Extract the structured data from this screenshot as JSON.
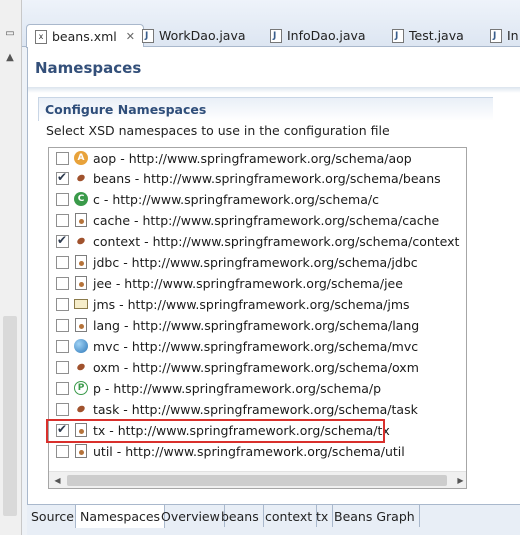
{
  "editor_tabs": [
    {
      "label": "beans.xml",
      "active": true,
      "closable": true,
      "icon": "xml-file-icon"
    },
    {
      "label": "WorkDao.java",
      "icon": "java-file-icon"
    },
    {
      "label": "InfoDao.java",
      "icon": "java-interface-icon"
    },
    {
      "label": "Test.java",
      "icon": "java-interface-icon"
    },
    {
      "label": "In",
      "icon": "java-interface-icon"
    }
  ],
  "page": {
    "title": "Namespaces",
    "section_title": "Configure Namespaces",
    "description": "Select XSD namespaces to use in the configuration file"
  },
  "namespaces": [
    {
      "label": "aop - http://www.springframework.org/schema/aop",
      "checked": false,
      "icon": "aop-icon"
    },
    {
      "label": "beans - http://www.springframework.org/schema/beans",
      "checked": true,
      "icon": "bean-icon"
    },
    {
      "label": "c - http://www.springframework.org/schema/c",
      "checked": false,
      "icon": "c-namespace-icon"
    },
    {
      "label": "cache - http://www.springframework.org/schema/cache",
      "checked": false,
      "icon": "xsd-file-icon"
    },
    {
      "label": "context - http://www.springframework.org/schema/context",
      "checked": true,
      "icon": "bean-icon"
    },
    {
      "label": "jdbc - http://www.springframework.org/schema/jdbc",
      "checked": false,
      "icon": "xsd-file-icon"
    },
    {
      "label": "jee - http://www.springframework.org/schema/jee",
      "checked": false,
      "icon": "xsd-file-icon"
    },
    {
      "label": "jms - http://www.springframework.org/schema/jms",
      "checked": false,
      "icon": "envelope-icon"
    },
    {
      "label": "lang - http://www.springframework.org/schema/lang",
      "checked": false,
      "icon": "xsd-file-icon"
    },
    {
      "label": "mvc - http://www.springframework.org/schema/mvc",
      "checked": false,
      "icon": "globe-icon"
    },
    {
      "label": "oxm - http://www.springframework.org/schema/oxm",
      "checked": false,
      "icon": "bean-icon"
    },
    {
      "label": "p - http://www.springframework.org/schema/p",
      "checked": false,
      "icon": "p-namespace-icon"
    },
    {
      "label": "task - http://www.springframework.org/schema/task",
      "checked": false,
      "icon": "task-icon"
    },
    {
      "label": "tx - http://www.springframework.org/schema/tx",
      "checked": true,
      "icon": "xsd-file-icon",
      "highlighted": true
    },
    {
      "label": "util - http://www.springframework.org/schema/util",
      "checked": false,
      "icon": "xsd-file-icon"
    }
  ],
  "bottom_tabs": [
    {
      "label": "Source"
    },
    {
      "label": "Namespaces",
      "active": true
    },
    {
      "label": "Overview"
    },
    {
      "label": "beans"
    },
    {
      "label": "context"
    },
    {
      "label": "tx"
    },
    {
      "label": "Beans Graph"
    }
  ],
  "colors": {
    "accent": "#34507a",
    "highlight": "#d9302c",
    "tab_bar": "#dde6f2"
  }
}
